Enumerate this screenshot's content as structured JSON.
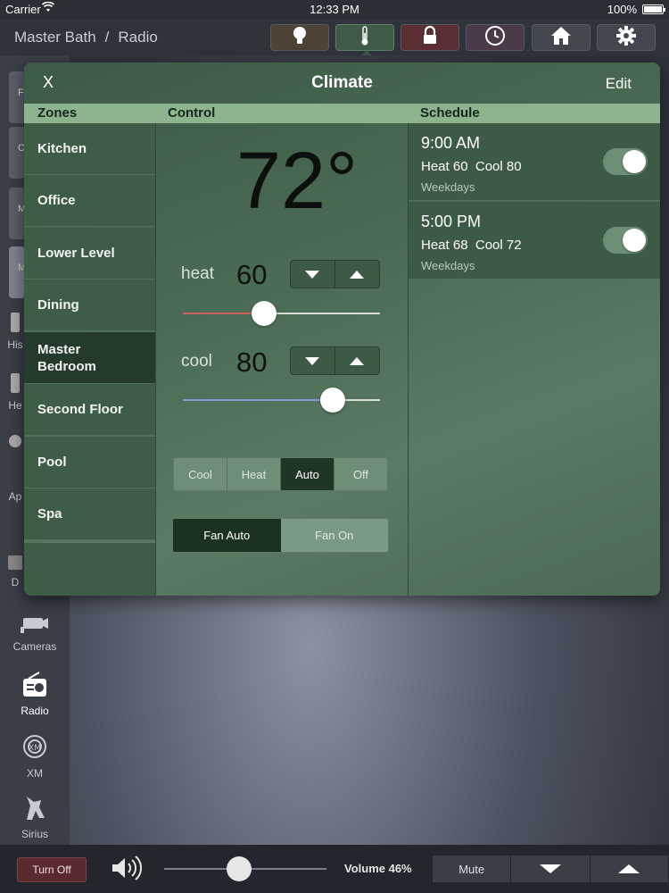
{
  "status_bar": {
    "carrier": "Carrier",
    "time": "12:33 PM",
    "battery": "100%"
  },
  "header": {
    "breadcrumb_room": "Master Bath",
    "breadcrumb_separator": "/",
    "breadcrumb_source": "Radio",
    "buttons": [
      "lightbulb-icon",
      "thermometer-icon",
      "lock-icon",
      "clock-icon",
      "home-icon",
      "gear-icon"
    ]
  },
  "rail": {
    "tiles": [
      "F",
      "C",
      "M",
      "M"
    ],
    "items": [
      {
        "label": "His",
        "icon": "speaker-icon"
      },
      {
        "label": "He",
        "icon": "speaker-icon"
      },
      {
        "label": "Ap",
        "icon": "apple-icon"
      },
      {
        "label": "D",
        "icon": "disc-icon"
      },
      {
        "label": "Cameras",
        "icon": "camera-icon"
      },
      {
        "label": "Radio",
        "icon": "radio-icon"
      },
      {
        "label": "XM",
        "icon": "xm-icon"
      },
      {
        "label": "Sirius",
        "icon": "sirius-dog-icon"
      }
    ]
  },
  "climate": {
    "close_label": "X",
    "title": "Climate",
    "edit_label": "Edit",
    "headers": {
      "zones": "Zones",
      "control": "Control",
      "schedule": "Schedule"
    },
    "zones": [
      "Kitchen",
      "Office",
      "Lower Level",
      "Dining",
      "Master Bedroom",
      "Second Floor",
      "Pool",
      "Spa"
    ],
    "selected_zone": "Master Bedroom",
    "current_temp": "72°",
    "heat": {
      "label": "heat",
      "value": "60",
      "slider_fraction": 0.41,
      "color": "#d06060"
    },
    "cool": {
      "label": "cool",
      "value": "80",
      "slider_fraction": 0.76,
      "color": "#7f9ad8"
    },
    "modes": [
      "Cool",
      "Heat",
      "Auto",
      "Off"
    ],
    "active_mode": "Auto",
    "fan_modes": [
      "Fan Auto",
      "Fan On"
    ],
    "active_fan": "Fan Auto",
    "schedule": [
      {
        "time": "9:00 AM",
        "settings": "Heat 60  Cool 80",
        "days": "Weekdays",
        "enabled": true
      },
      {
        "time": "5:00 PM",
        "settings": "Heat 68  Cool 72",
        "days": "Weekdays",
        "enabled": true
      }
    ]
  },
  "bottom_bar": {
    "turn_off_label": "Turn Off",
    "volume_label": "Volume 46%",
    "volume_fraction": 0.46,
    "mute_label": "Mute"
  },
  "colors": {
    "panel_green": "#4a6b53",
    "header_green": "#8db38f",
    "selected_zone": "#243a2a",
    "turn_off_red": "#5b2a2d"
  }
}
